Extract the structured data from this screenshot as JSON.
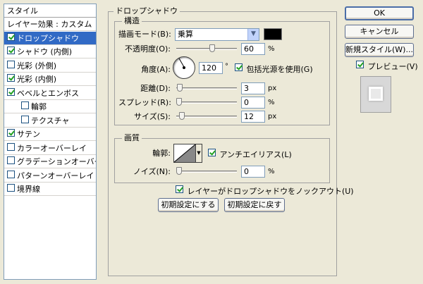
{
  "sidebar": {
    "header": "スタイル",
    "items": [
      {
        "label": "レイヤー効果 : カスタム",
        "checkbox": false,
        "checked": false,
        "indent": false,
        "selected": false
      },
      {
        "label": "ドロップシャドウ",
        "checkbox": true,
        "checked": true,
        "indent": false,
        "selected": true
      },
      {
        "label": "シャドウ (内側)",
        "checkbox": true,
        "checked": true,
        "indent": false,
        "selected": false
      },
      {
        "label": "光彩 (外側)",
        "checkbox": true,
        "checked": false,
        "indent": false,
        "selected": false
      },
      {
        "label": "光彩 (内側)",
        "checkbox": true,
        "checked": true,
        "indent": false,
        "selected": false
      },
      {
        "label": "ベベルとエンボス",
        "checkbox": true,
        "checked": true,
        "indent": false,
        "selected": false
      },
      {
        "label": "輪郭",
        "checkbox": true,
        "checked": false,
        "indent": true,
        "selected": false
      },
      {
        "label": "テクスチャ",
        "checkbox": true,
        "checked": false,
        "indent": true,
        "selected": false
      },
      {
        "label": "サテン",
        "checkbox": true,
        "checked": true,
        "indent": false,
        "selected": false
      },
      {
        "label": "カラーオーバーレイ",
        "checkbox": true,
        "checked": false,
        "indent": false,
        "selected": false
      },
      {
        "label": "グラデーションオーバーレイ",
        "checkbox": true,
        "checked": false,
        "indent": false,
        "selected": false
      },
      {
        "label": "パターンオーバーレイ",
        "checkbox": true,
        "checked": false,
        "indent": false,
        "selected": false
      },
      {
        "label": "境界線",
        "checkbox": true,
        "checked": false,
        "indent": false,
        "selected": false
      }
    ]
  },
  "drop_shadow": {
    "title": "ドロップシャドウ",
    "structure": {
      "title": "構造",
      "blend_mode_label": "描画モード(B):",
      "blend_mode_value": "乗算",
      "shadow_color": "#000000",
      "opacity_label": "不透明度(O):",
      "opacity_value": "60",
      "opacity_unit": "%",
      "opacity_fraction": 0.6,
      "angle_label": "角度(A):",
      "angle_value": "120",
      "angle_unit": "°",
      "global_light_label": "包括光源を使用(G)",
      "global_light_checked": true,
      "distance_label": "距離(D):",
      "distance_value": "3",
      "distance_unit": "px",
      "distance_fraction": 0.01,
      "spread_label": "スプレッド(R):",
      "spread_value": "0",
      "spread_unit": "%",
      "spread_fraction": 0.0,
      "size_label": "サイズ(S):",
      "size_value": "12",
      "size_unit": "px",
      "size_fraction": 0.05
    },
    "quality": {
      "title": "画質",
      "contour_label": "輪郭:",
      "anti_alias_label": "アンチエイリアス(L)",
      "anti_alias_checked": true,
      "noise_label": "ノイズ(N):",
      "noise_value": "0",
      "noise_unit": "%",
      "noise_fraction": 0.0
    },
    "knockout_label": "レイヤーがドロップシャドウをノックアウト(U)",
    "knockout_checked": true,
    "make_default_label": "初期設定にする",
    "reset_default_label": "初期設定に戻す"
  },
  "buttons": {
    "ok": "OK",
    "cancel": "キャンセル",
    "new_style": "新規スタイル(W)...",
    "preview_label": "プレビュー(V)",
    "preview_checked": true
  }
}
